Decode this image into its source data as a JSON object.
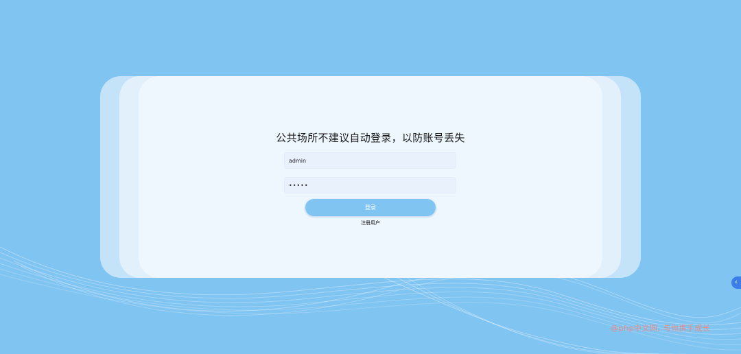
{
  "login": {
    "title": "公共场所不建议自动登录，以防账号丢失",
    "username_value": "admin",
    "password_value": "•••••",
    "login_button_label": "登录",
    "register_link_label": "注册用户"
  },
  "side_tab": {
    "icon": "chevron-left-icon",
    "glyph": "‹"
  },
  "watermark": {
    "text": "@php中文网, 与你携手成长"
  },
  "colors": {
    "background": "#80c4f2",
    "card": "#eff7fe",
    "input_bg": "#e9f1fd",
    "button": "#80c4f2",
    "side_tab": "#3d7de8",
    "watermark": "#e98b86"
  }
}
